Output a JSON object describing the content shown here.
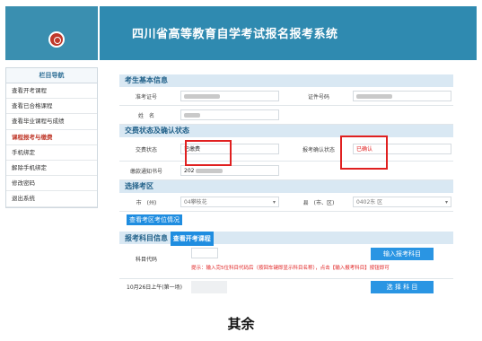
{
  "header": {
    "title": "四川省高等教育自学考试报名报考系统"
  },
  "sidebar": {
    "heading": "栏目导航",
    "items": [
      {
        "label": "查看开考课程"
      },
      {
        "label": "查看已合格课程"
      },
      {
        "label": "查看毕业课程与成绩"
      },
      {
        "label": "课程报考与缴费"
      },
      {
        "label": "手机绑定"
      },
      {
        "label": "解除手机绑定"
      },
      {
        "label": "修改密码"
      },
      {
        "label": "退出系统"
      }
    ]
  },
  "basic": {
    "heading": "考生基本信息",
    "exam_id_label": "准考证号",
    "id_label": "证件号码",
    "name_label": "姓　名"
  },
  "payment": {
    "heading": "交费状态及确认状态",
    "pay_status_label": "交费状态",
    "pay_status_value": "已缴费",
    "confirm_label": "报考确认状态",
    "confirm_value": "已确认",
    "notice_label": "缴款通知书号",
    "notice_value": "202"
  },
  "area": {
    "heading": "选择考区",
    "city_label": "市　(州)",
    "city_value": "04攀枝花",
    "county_label": "县　(市、区)",
    "county_value": "0402东 区",
    "view_button": "查看考区考位情况"
  },
  "subjects": {
    "heading": "报考科目信息",
    "view_courses_button": "查看开考课程",
    "code_label": "科目代码",
    "tip": "提示：输入完5位科目代码后（按回车键即显示科目名称），点击【输入报考科目】按钮即可",
    "input_button": "输入报考科目",
    "date_label": "10月26日上午(第一场)",
    "select_button": "选 择 科 目"
  },
  "caption": "其余"
}
